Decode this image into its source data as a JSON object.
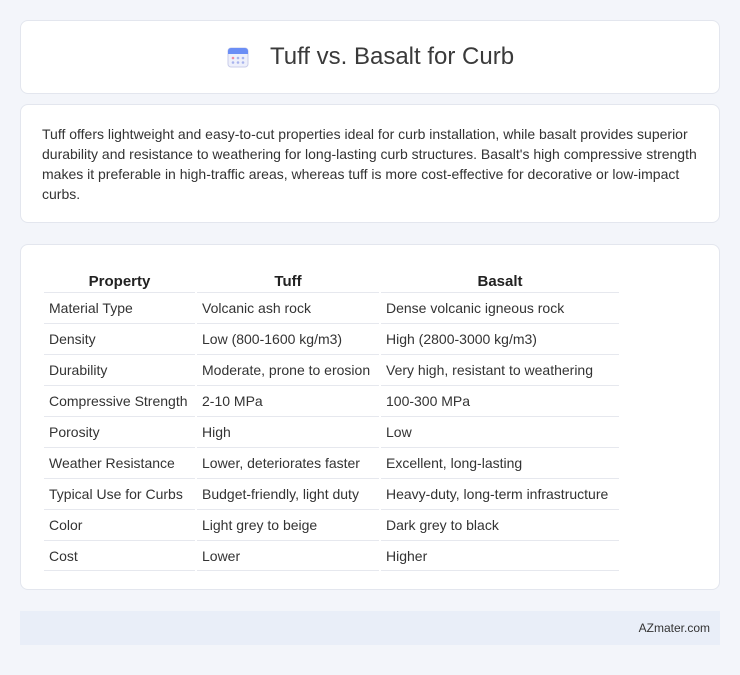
{
  "header": {
    "title": "Tuff vs. Basalt for Curb",
    "icon": "calendar-icon"
  },
  "summary": {
    "text": "Tuff offers lightweight and easy-to-cut properties ideal for curb installation, while basalt provides superior durability and resistance to weathering for long-lasting curb structures. Basalt's high compressive strength makes it preferable in high-traffic areas, whereas tuff is more cost-effective for decorative or low-impact curbs."
  },
  "table": {
    "headers": [
      "Property",
      "Tuff",
      "Basalt"
    ],
    "rows": [
      [
        "Material Type",
        "Volcanic ash rock",
        "Dense volcanic igneous rock"
      ],
      [
        "Density",
        "Low (800-1600 kg/m3)",
        "High (2800-3000 kg/m3)"
      ],
      [
        "Durability",
        "Moderate, prone to erosion",
        "Very high, resistant to weathering"
      ],
      [
        "Compressive Strength",
        "2-10 MPa",
        "100-300 MPa"
      ],
      [
        "Porosity",
        "High",
        "Low"
      ],
      [
        "Weather Resistance",
        "Lower, deteriorates faster",
        "Excellent, long-lasting"
      ],
      [
        "Typical Use for Curbs",
        "Budget-friendly, light duty",
        "Heavy-duty, long-term infrastructure"
      ],
      [
        "Color",
        "Light grey to beige",
        "Dark grey to black"
      ],
      [
        "Cost",
        "Lower",
        "Higher"
      ]
    ]
  },
  "footer": {
    "site": "AZmater.com"
  },
  "colors": {
    "background": "#f3f5fa",
    "card": "#ffffff",
    "footer": "#e9eef8",
    "icon_accent": "#6b8ef5"
  }
}
